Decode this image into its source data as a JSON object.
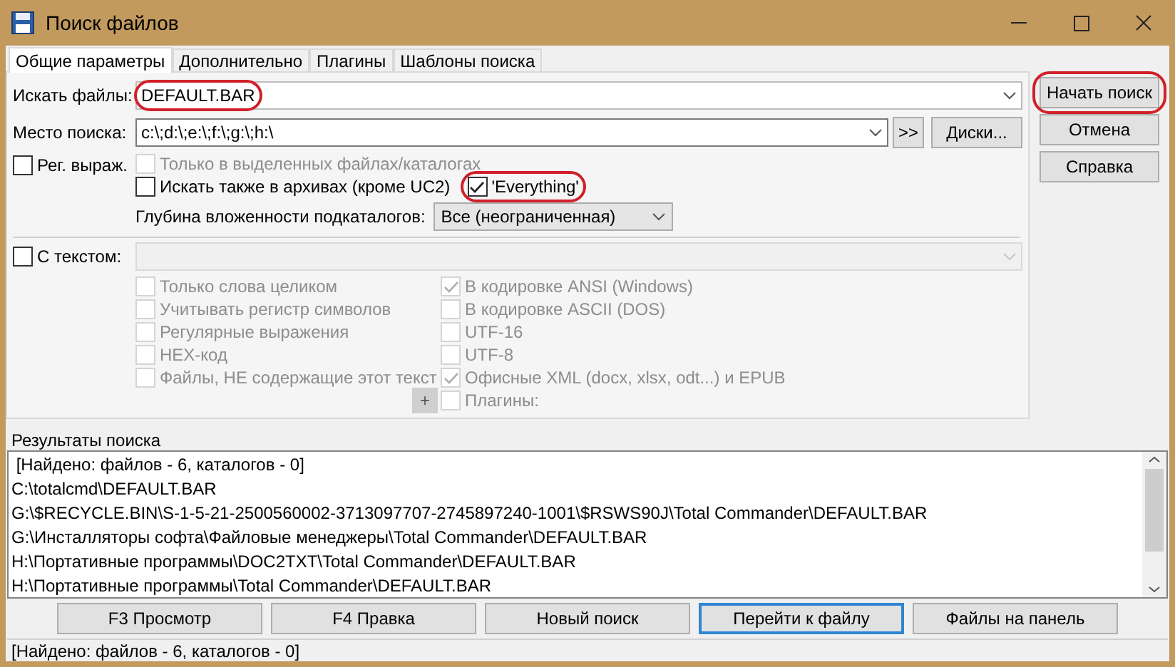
{
  "window": {
    "title": "Поиск файлов"
  },
  "tabs": [
    {
      "label": "Общие параметры",
      "selected": true
    },
    {
      "label": "Дополнительно",
      "selected": false
    },
    {
      "label": "Плагины",
      "selected": false
    },
    {
      "label": "Шаблоны поиска",
      "selected": false
    }
  ],
  "search_files": {
    "label": "Искать файлы:",
    "value": "DEFAULT.BAR",
    "highlighted": true
  },
  "search_in": {
    "label": "Место поиска:",
    "value": "c:\\;d:\\;e:\\;f:\\;g:\\;h:\\",
    "browse_button": ">>",
    "drives_button": "Диски..."
  },
  "regex": {
    "label": "Рег. выраж.",
    "checked": false,
    "disabled": false
  },
  "only_selected": {
    "label": "Только в выделенных файлах/каталогах",
    "checked": false,
    "disabled": true
  },
  "archives": {
    "label": "Искать также в архивах (кроме UC2)",
    "checked": false,
    "disabled": false
  },
  "everything": {
    "label": "'Everything'",
    "checked": true,
    "disabled": false,
    "highlighted": true
  },
  "depth": {
    "label": "Глубина вложенности подкаталогов:",
    "value": "Все (неограниченная)"
  },
  "with_text": {
    "label": "С текстом:",
    "checked": false,
    "disabled": false
  },
  "text_options_left": [
    {
      "label": "Только слова целиком",
      "checked": false,
      "disabled": true
    },
    {
      "label": "Учитывать регистр символов",
      "checked": false,
      "disabled": true
    },
    {
      "label": "Регулярные выражения",
      "checked": false,
      "disabled": true
    },
    {
      "label": "HEX-код",
      "checked": false,
      "disabled": true
    },
    {
      "label": "Файлы, НЕ содержащие этот текст",
      "checked": false,
      "disabled": true
    }
  ],
  "text_options_right": [
    {
      "label": "В кодировке ANSI (Windows)",
      "checked": true,
      "disabled": true
    },
    {
      "label": "В кодировке ASCII (DOS)",
      "checked": false,
      "disabled": true
    },
    {
      "label": "UTF-16",
      "checked": false,
      "disabled": true
    },
    {
      "label": "UTF-8",
      "checked": false,
      "disabled": true
    },
    {
      "label": "Офисные XML (docx, xlsx, odt...) и EPUB",
      "checked": true,
      "disabled": true
    },
    {
      "label": "Плагины:",
      "checked": false,
      "disabled": true
    }
  ],
  "plus_button": "+",
  "side_buttons": [
    {
      "label": "Начать поиск",
      "highlighted": true
    },
    {
      "label": "Отмена",
      "highlighted": false
    },
    {
      "label": "Справка",
      "highlighted": false
    }
  ],
  "results": {
    "label": "Результаты поиска",
    "rows": [
      " [Найдено: файлов - 6, каталогов - 0]",
      "C:\\totalcmd\\DEFAULT.BAR",
      "G:\\$RECYCLE.BIN\\S-1-5-21-2500560002-3713097707-2745897240-1001\\$RSWS90J\\Total Commander\\DEFAULT.BAR",
      "G:\\Инсталляторы софта\\Файловые менеджеры\\Total Commander\\DEFAULT.BAR",
      "H:\\Портативные программы\\DOC2TXT\\Total Commander\\DEFAULT.BAR",
      "H:\\Портативные программы\\Total Commander\\DEFAULT.BAR"
    ]
  },
  "bottom_buttons": [
    {
      "label": "F3 Просмотр",
      "focused": false
    },
    {
      "label": "F4 Правка",
      "focused": false
    },
    {
      "label": "Новый поиск",
      "focused": false
    },
    {
      "label": "Перейти к файлу",
      "focused": true
    },
    {
      "label": "Файлы на панель",
      "focused": false
    }
  ],
  "status_bar": "[Найдено: файлов - 6, каталогов - 0]"
}
